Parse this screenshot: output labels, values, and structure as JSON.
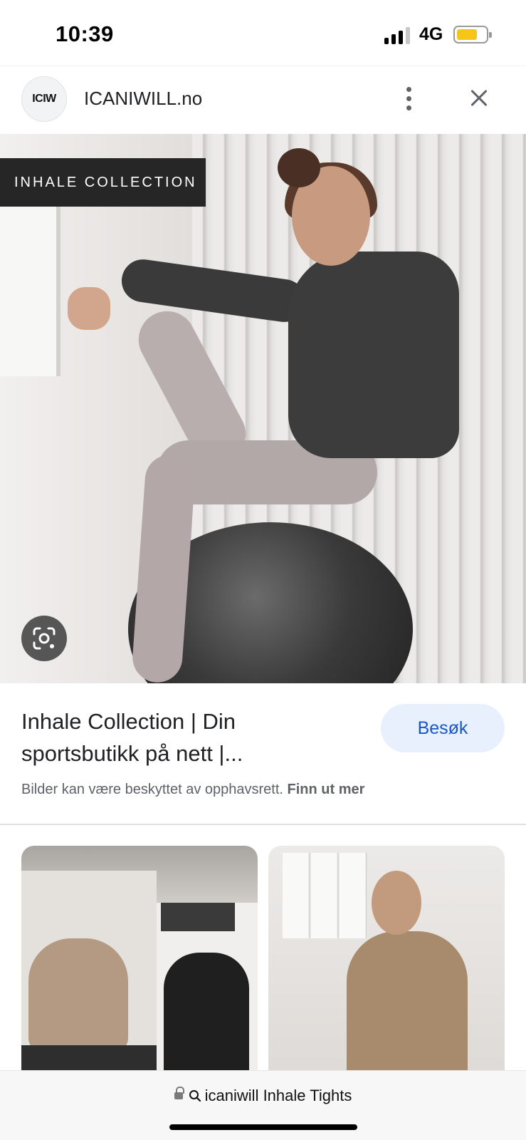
{
  "status_bar": {
    "time": "10:39",
    "network": "4G",
    "battery_color": "#f5c518"
  },
  "site_header": {
    "logo_text": "ICIW",
    "site_name": "ICANIWILL.no",
    "menu_icon": "kebab-menu-icon",
    "close_icon": "close-icon"
  },
  "hero": {
    "badge_text": "INHALE COLLECTION",
    "lens_icon": "google-lens-icon"
  },
  "result": {
    "title": "Inhale Collection | Din sportsbutikk på nett |...",
    "visit_label": "Besøk",
    "copyright_text": "Bilder kan være beskyttet av opphavsrett.",
    "learn_more_label": "Finn ut mer"
  },
  "bottom_bar": {
    "query": "icaniwill Inhale Tights",
    "lock_icon": "lock-icon",
    "search_icon": "search-icon"
  },
  "colors": {
    "accent_blue": "#1a56c8",
    "visit_bg": "#e8f0fe",
    "badge_bg": "#262626"
  }
}
